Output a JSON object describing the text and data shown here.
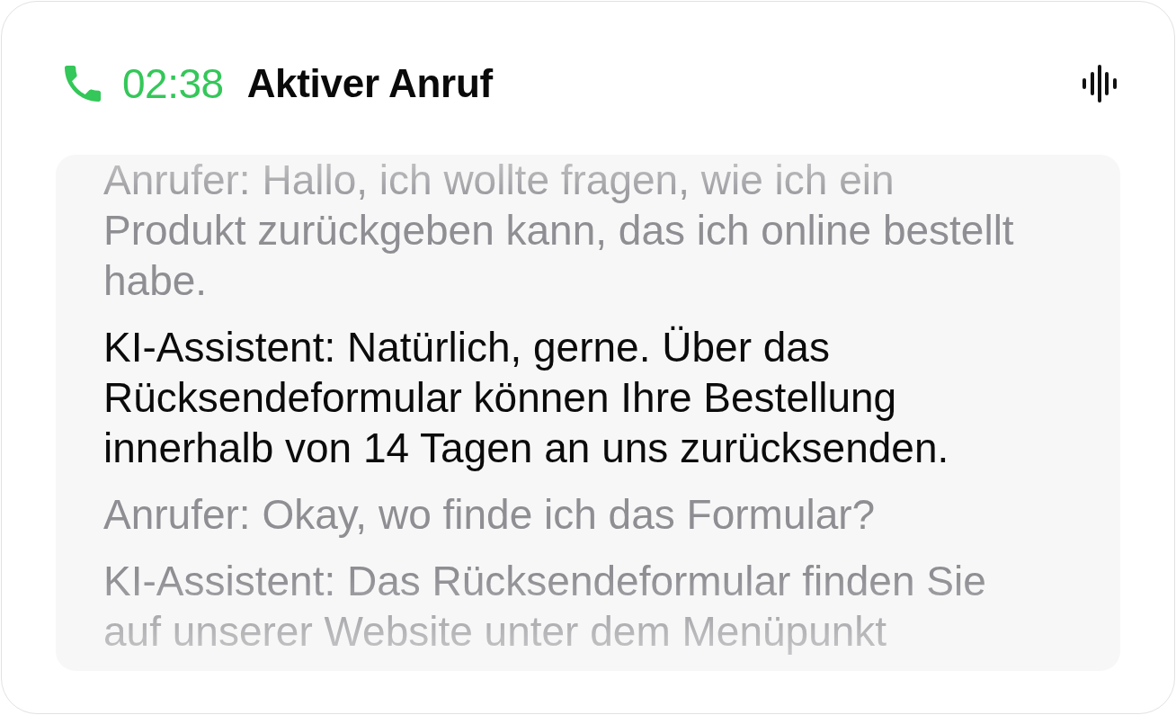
{
  "header": {
    "timer": "02:38",
    "title": "Aktiver Anruf"
  },
  "transcript": {
    "messages": [
      {
        "text": "Anrufer: Hallo, ich wollte fragen, wie ich ein Produkt zurückgeben kann, das ich online bestellt habe.",
        "active": false
      },
      {
        "text": "KI-Assistent: Natürlich, gerne. Über das Rücksendeformular können Ihre Bestellung innerhalb von 14 Tagen an uns zurücksenden.",
        "active": true
      },
      {
        "text": "Anrufer: Okay, wo finde ich das Formular?",
        "active": false
      },
      {
        "text": "KI-Assistent: Das Rücksendeformular finden Sie auf unserer Website unter dem Menüpunkt",
        "active": false
      }
    ]
  }
}
